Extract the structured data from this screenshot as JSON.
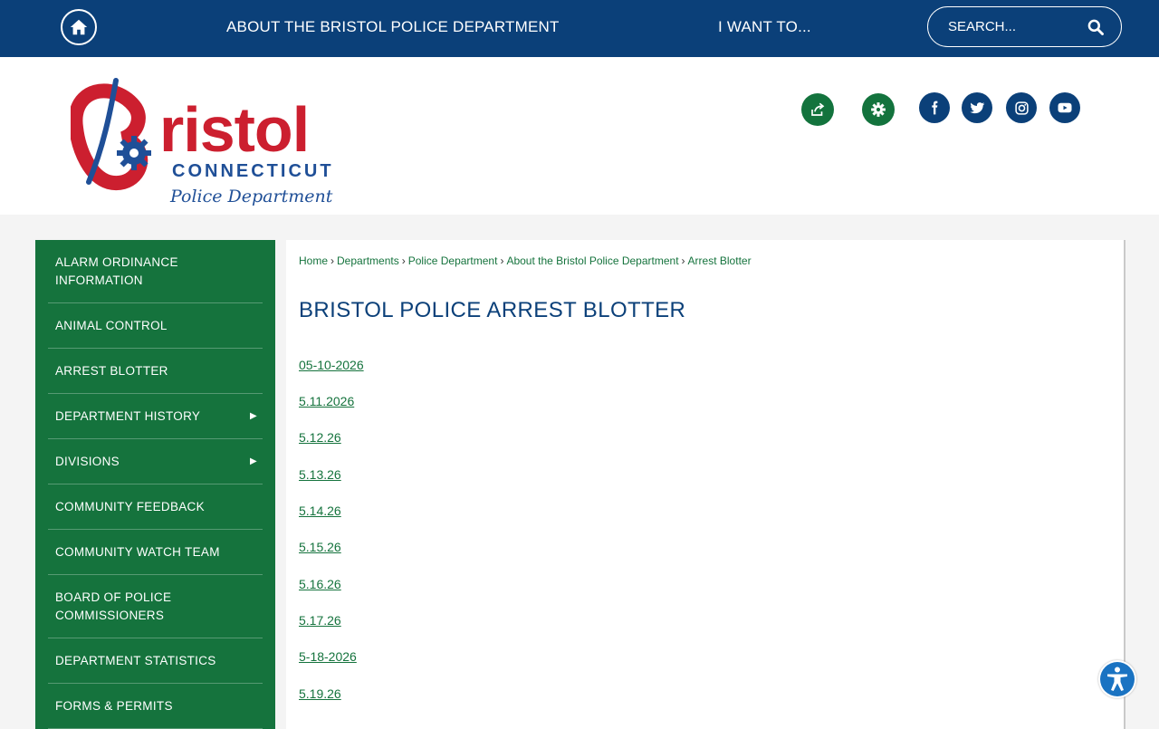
{
  "topbar": {
    "about_label": "ABOUT THE BRISTOL POLICE DEPARTMENT",
    "iwant_label": "I WANT TO...",
    "search_placeholder": "SEARCH..."
  },
  "logo": {
    "name": "Bristol",
    "state": "CONNECTICUT",
    "dept": "Police Department"
  },
  "header_icons": [
    "share-icon",
    "gear-icon",
    "facebook-icon",
    "twitter-icon",
    "instagram-icon",
    "youtube-icon"
  ],
  "sidebar": {
    "items": [
      {
        "label": "ALARM ORDINANCE INFORMATION",
        "has_submenu": false
      },
      {
        "label": "ANIMAL CONTROL",
        "has_submenu": false
      },
      {
        "label": "ARREST BLOTTER",
        "has_submenu": false
      },
      {
        "label": "DEPARTMENT HISTORY",
        "has_submenu": true
      },
      {
        "label": "DIVISIONS",
        "has_submenu": true
      },
      {
        "label": "COMMUNITY FEEDBACK",
        "has_submenu": false
      },
      {
        "label": "COMMUNITY WATCH TEAM",
        "has_submenu": false
      },
      {
        "label": "BOARD OF POLICE COMMISSIONERS",
        "has_submenu": false
      },
      {
        "label": "DEPARTMENT STATISTICS",
        "has_submenu": false
      },
      {
        "label": "FORMS & PERMITS",
        "has_submenu": false
      }
    ],
    "arrow_glyph": "▶"
  },
  "breadcrumb": {
    "items": [
      "Home",
      "Departments",
      "Police Department",
      "About the Bristol Police Department",
      "Arrest Blotter"
    ],
    "separator": "›"
  },
  "main": {
    "title": "BRISTOL POLICE ARREST BLOTTER",
    "links": [
      "05-10-2026",
      "5.11.2026",
      "5.12.26",
      "5.13.26",
      "5.14.26",
      "5.15.26",
      "5.16.26",
      "5.17.26",
      "5-18-2026",
      "5.19.26"
    ]
  },
  "colors": {
    "navy": "#0b4079",
    "green": "#15733d",
    "logo_red": "#cc1f2f"
  }
}
